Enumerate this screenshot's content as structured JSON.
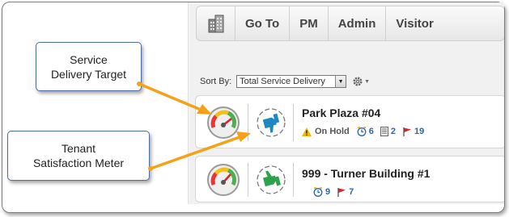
{
  "callouts": {
    "service_delivery": [
      "Service",
      "Delivery Target"
    ],
    "tenant_satisfaction": [
      "Tenant",
      "Satisfaction Meter"
    ]
  },
  "nav": {
    "items": [
      "Go To",
      "PM",
      "Admin",
      "Visitor"
    ]
  },
  "sort": {
    "label": "Sort By:",
    "selected": "Total Service Delivery"
  },
  "buildings": [
    {
      "name": "Park Plaza #04",
      "status": "On Hold",
      "metrics": [
        {
          "icon": "clock-icon",
          "value": "6"
        },
        {
          "icon": "document-icon",
          "value": "2"
        },
        {
          "icon": "flag-icon",
          "value": "19"
        }
      ]
    },
    {
      "name": "999 - Turner Building #1",
      "metrics": [
        {
          "icon": "clock-icon",
          "value": "9"
        },
        {
          "icon": "flag-icon",
          "value": "7"
        }
      ]
    }
  ],
  "colors": {
    "arrow": "#f5a21b",
    "callout_border": "#4a6fa8",
    "link_blue": "#2a66b8",
    "thumb_down": "#1e88c7",
    "thumb_up": "#2ea24a",
    "flag": "#d8262b"
  }
}
